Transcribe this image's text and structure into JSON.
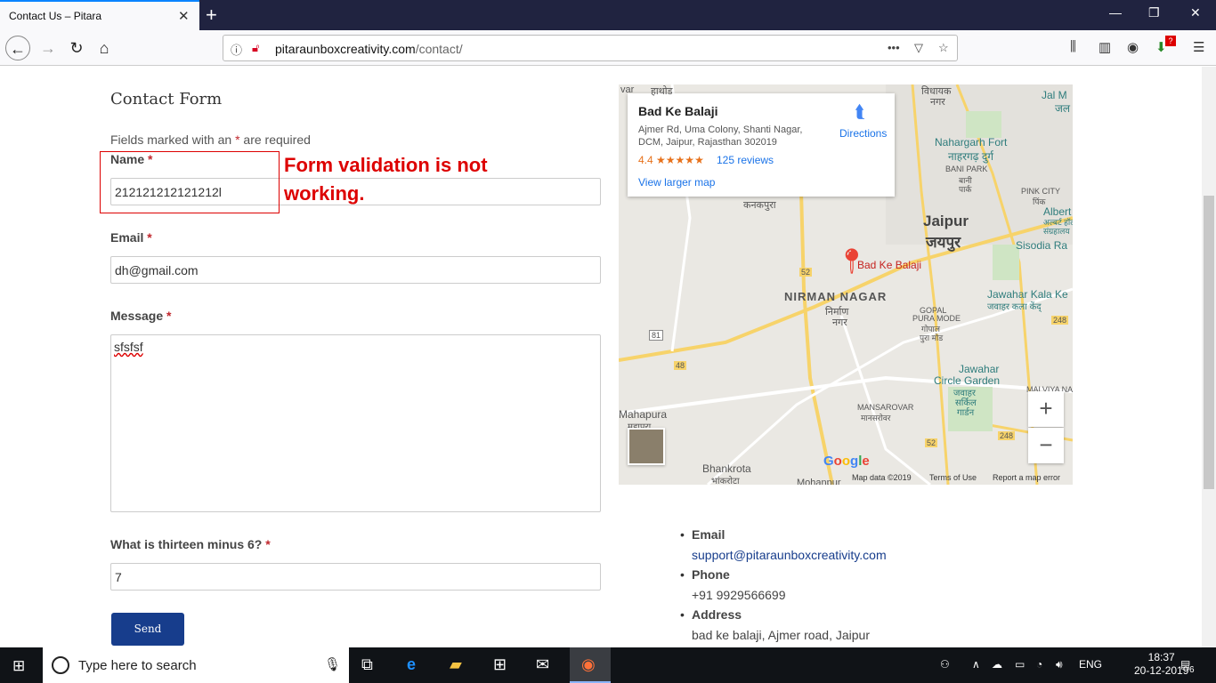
{
  "browser": {
    "tab_title": "Contact Us – Pitara",
    "url_domain": "pitaraunboxcreativity.com",
    "url_path": "/contact/",
    "notification_badge": "?"
  },
  "form": {
    "title": "Contact Form",
    "fields_note_pre": "Fields marked with an ",
    "required_mark": "*",
    "fields_note_post": " are required",
    "name_label": "Name",
    "name_value": "212121212121212l",
    "email_label": "Email",
    "email_value": "dh@gmail.com",
    "message_label": "Message",
    "message_value": "sfsfsf",
    "captcha_label": "What is thirteen minus 6?",
    "captcha_value": "7",
    "send_label": "Send"
  },
  "annotation": {
    "text": "Form validation is not working."
  },
  "map": {
    "place_name": "Bad Ke Balaji",
    "address": "Ajmer Rd, Uma Colony, Shanti Nagar, DCM, Jaipur, Rajasthan 302019",
    "rating": "4.4",
    "stars": "★★★★★",
    "reviews": "125 reviews",
    "view_larger": "View larger map",
    "directions": "Directions",
    "pin_label": "Bad Ke Balaji",
    "labels": {
      "jaipur": "Jaipur",
      "jaipur_hi": "जयपुर",
      "nirman": "NIRMAN NAGAR",
      "nirman_hi": "निर्माण",
      "nirman_hi2": "नगर",
      "nahargarh": "Nahargarh Fort",
      "nahargarh_hi": "नाहरगढ़ दुर्ग",
      "bani_park": "BANI PARK",
      "bani_hi": "बानी",
      "bani_hi2": "पार्क",
      "pink_city": "PINK CITY",
      "pink_hi": "पिंक",
      "albert": "Albert",
      "albert_hi": "अल्बर्ट हॉल",
      "albert_hi2": "संग्रहालय",
      "sisodia": "Sisodia Ra",
      "jawahar_kala": "Jawahar Kala Ke",
      "jawahar_kala_hi": "जवाहर कला केंद्",
      "gopal": "GOPAL",
      "pura_mode": "PURA MODE",
      "gopal_hi": "गोपाल",
      "pura_hi": "पुरा मोड",
      "jawahar": "Jawahar",
      "circle_garden": "Circle Garden",
      "jawahar_hi": "जवाहर",
      "circle_hi": "सर्किल",
      "garden_hi": "गार्डन",
      "malviya": "MALVIYA NAGA",
      "mansarovar": "MANSAROVAR",
      "mansarovar_hi": "मानसरोवर",
      "mahapura": "Mahapura",
      "mahapura_hi": "महापुरा",
      "bhankrota": "Bhankrota",
      "bhankrota_hi": "भांकरोटा",
      "mohanpur": "Mohanpur",
      "kanakpura": "कनकपुरा",
      "jal_mahal": "Jal M",
      "jal_hi": "जल",
      "vidhayak": "विधायक",
      "nagar_hi": "नगर",
      "var": "var",
      "hathod": "हाथोड",
      "r52": "52",
      "r81": "81",
      "r48": "48",
      "r248": "248",
      "r248b": "248",
      "r52b": "52"
    },
    "google": "Google",
    "map_data": "Map data ©2019",
    "terms": "Terms of Use",
    "report": "Report a map error",
    "zoom_in": "+",
    "zoom_out": "−"
  },
  "contact": {
    "email_label": "Email",
    "email_value": "support@pitaraunboxcreativity.com",
    "phone_label": "Phone",
    "phone_value": "+91 9929566699",
    "address_label": "Address",
    "address_value": "bad ke balaji, Ajmer road, Jaipur"
  },
  "taskbar": {
    "search_placeholder": "Type here to search",
    "language": "ENG",
    "time": "18:37",
    "date": "20-12-2019",
    "notification_count": "6"
  }
}
